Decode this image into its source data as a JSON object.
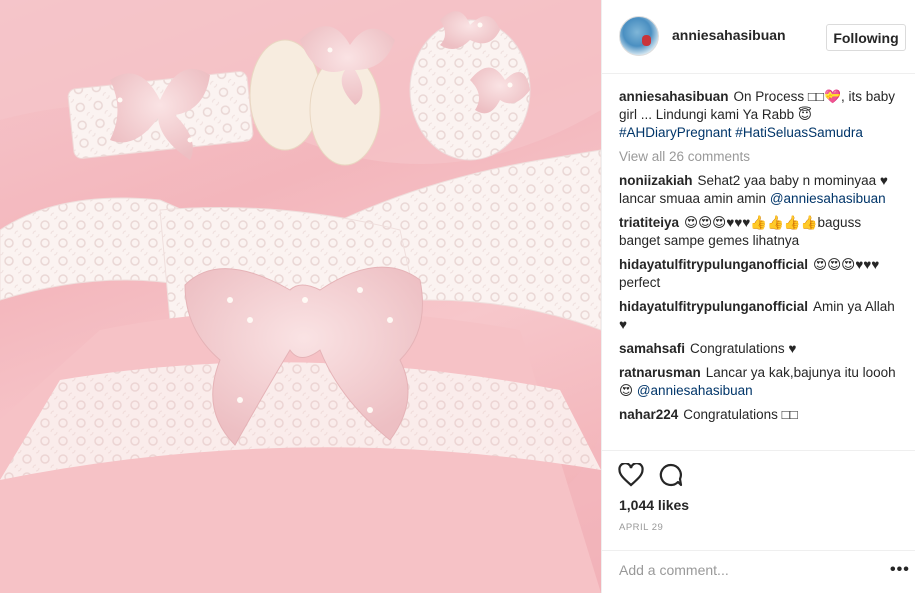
{
  "post": {
    "username": "anniesahasibuan",
    "follow_label": "Following",
    "caption": {
      "user": "anniesahasibuan",
      "text": "On Process □□💝, its baby girl ... Lindungi kami Ya Rabb 😇",
      "hashtags": "#AHDiaryPregnant #HatiSeluasSamudra"
    },
    "view_all": "View all 26 comments",
    "comments": [
      {
        "user": "noniizakiah",
        "text": "Sehat2 yaa baby n mominyaa ♥ lancar smuaa amin amin",
        "mention": "@anniesahasibuan"
      },
      {
        "user": "triatiteiya",
        "text": "😍😍😍♥♥♥👍👍👍👍baguss banget sampe gemes lihatnya",
        "mention": ""
      },
      {
        "user": "hidayatulfitrypulunganofficial",
        "text": "😍😍😍♥♥♥ perfect",
        "mention": ""
      },
      {
        "user": "hidayatulfitrypulunganofficial",
        "text": "Amin ya Allah ♥",
        "mention": ""
      },
      {
        "user": "samahsafi",
        "text": "Congratulations ♥",
        "mention": ""
      },
      {
        "user": "ratnarusman",
        "text": "Lancar ya kak,bajunya itu loooh😍",
        "mention": "@anniesahasibuan"
      },
      {
        "user": "nahar224",
        "text": "Congratulations □□",
        "mention": ""
      }
    ],
    "likes": "1,044 likes",
    "date": "APRIL 29",
    "comment_placeholder": "Add a comment...",
    "more_label": "•••"
  },
  "icons": {
    "like": "heart-icon",
    "comment": "comment-bubble-icon",
    "more": "more-options-icon"
  },
  "colors": {
    "link": "#003569",
    "muted": "#999999",
    "text": "#262626",
    "border": "#dbdbdb"
  }
}
